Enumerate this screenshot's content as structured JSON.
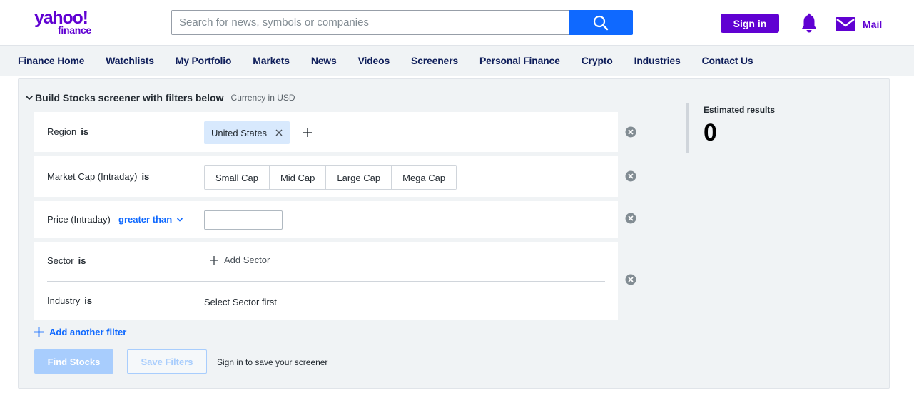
{
  "header": {
    "logo_line1": "yahoo!",
    "logo_line2": "finance",
    "search_placeholder": "Search for news, symbols or companies",
    "search_value": "",
    "signin_label": "Sign in",
    "mail_label": "Mail"
  },
  "nav": {
    "items": [
      "Finance Home",
      "Watchlists",
      "My Portfolio",
      "Markets",
      "News",
      "Videos",
      "Screeners",
      "Personal Finance",
      "Crypto",
      "Industries",
      "Contact Us"
    ]
  },
  "screener": {
    "title": "Build Stocks screener with filters below",
    "currency_note": "Currency in USD",
    "filters": {
      "region": {
        "label": "Region",
        "is": "is",
        "selected": "United States"
      },
      "market_cap": {
        "label": "Market Cap (Intraday)",
        "is": "is",
        "options": [
          "Small Cap",
          "Mid Cap",
          "Large Cap",
          "Mega Cap"
        ]
      },
      "price": {
        "label": "Price (Intraday)",
        "operator": "greater than",
        "value": ""
      },
      "sector": {
        "label": "Sector",
        "is": "is",
        "add_label": "Add Sector"
      },
      "industry": {
        "label": "Industry",
        "is": "is",
        "placeholder_text": "Select Sector first"
      }
    },
    "add_filter_label": "Add another filter",
    "find_label": "Find Stocks",
    "save_label": "Save Filters",
    "signin_note": "Sign in to save your screener",
    "results_label": "Estimated results",
    "results_value": "0"
  },
  "colors": {
    "brand": "#6001d2",
    "accent": "#0f69ff",
    "panel_bg": "#f0f3f5",
    "chip_bg": "#d8e9fd"
  },
  "icons": [
    "search-icon",
    "bell-icon",
    "mail-icon",
    "chevron-down-icon",
    "close-icon",
    "plus-icon",
    "remove-circle-icon"
  ]
}
